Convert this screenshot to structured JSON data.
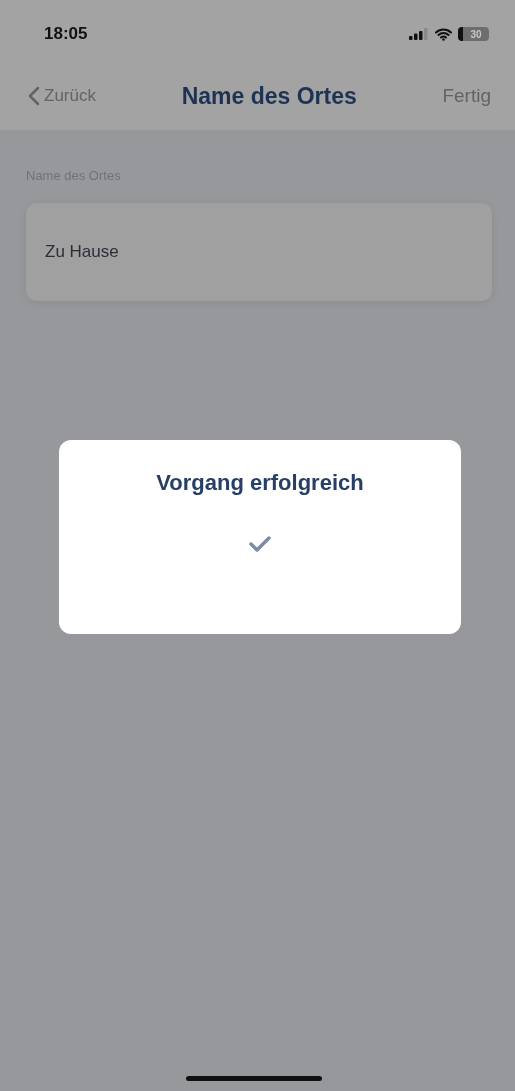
{
  "status_bar": {
    "time": "18:05",
    "battery": "30"
  },
  "nav_bar": {
    "back": "Zurück",
    "title": "Name des Ortes",
    "action": "Fertig"
  },
  "form": {
    "label": "Name des Ortes",
    "value": "Zu Hause"
  },
  "dialog": {
    "title": "Vorgang erfolgreich",
    "success": true
  }
}
